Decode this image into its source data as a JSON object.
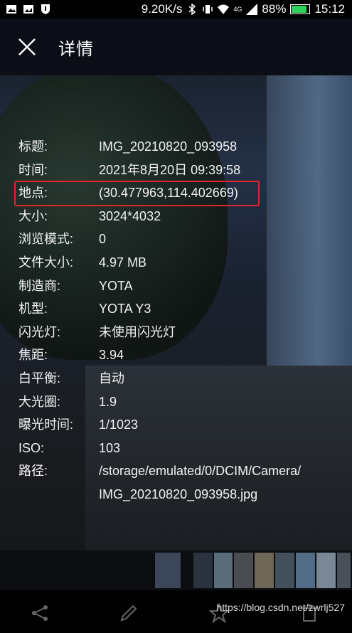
{
  "status_bar": {
    "speed": "9.20K/s",
    "network": "4G",
    "battery_percent": "88%",
    "battery_level": 0.88,
    "time": "15:12"
  },
  "header": {
    "title": "详情"
  },
  "details": [
    {
      "label": "标题:",
      "value": "IMG_20210820_093958"
    },
    {
      "label": "时间:",
      "value": "2021年8月20日 09:39:58"
    },
    {
      "label": "地点:",
      "value": "(30.477963,114.402669)"
    },
    {
      "label": "大小:",
      "value": "3024*4032"
    },
    {
      "label": "浏览模式:",
      "value": "0"
    },
    {
      "label": "文件大小:",
      "value": "4.97 MB"
    },
    {
      "label": "制造商:",
      "value": "YOTA"
    },
    {
      "label": "机型:",
      "value": "YOTA Y3"
    },
    {
      "label": "闪光灯:",
      "value": "未使用闪光灯"
    },
    {
      "label": "焦距:",
      "value": "3.94"
    },
    {
      "label": "白平衡:",
      "value": "自动"
    },
    {
      "label": "大光圈:",
      "value": "1.9"
    },
    {
      "label": "曝光时间:",
      "value": "1/1023"
    },
    {
      "label": "ISO:",
      "value": "103"
    },
    {
      "label": "路径:",
      "value": "/storage/emulated/0/DCIM/Camera/"
    },
    {
      "label": "",
      "value": "IMG_20210820_093958.jpg"
    }
  ],
  "watermark": "https://blog.csdn.net/zwrlj527",
  "colors": {
    "highlight": "#e0262a",
    "battery": "#2fd15c"
  },
  "icons": {
    "close": "close-icon",
    "share": "share-icon",
    "edit": "edit-icon",
    "favorite": "star-icon",
    "delete": "trash-icon"
  }
}
